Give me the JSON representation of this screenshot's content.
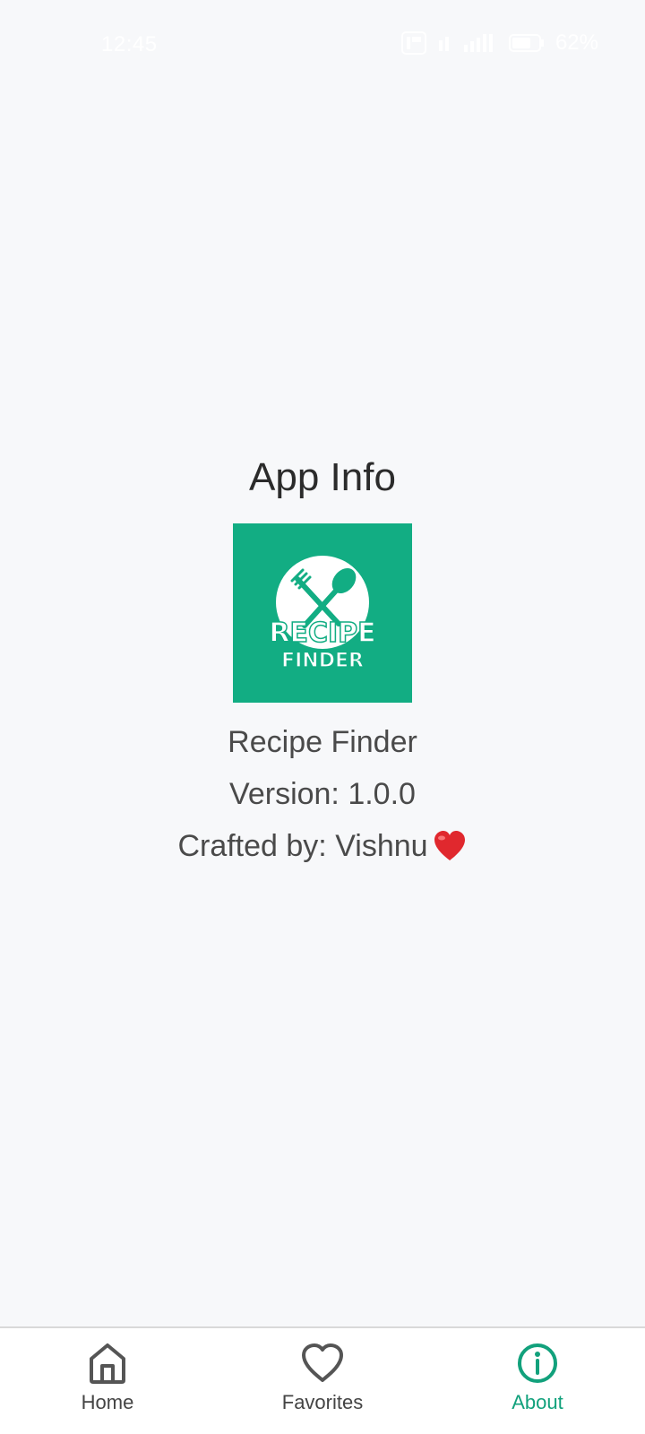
{
  "status_bar": {
    "time": "12:45",
    "battery": "62%"
  },
  "about": {
    "title": "App Info",
    "app_name": "Recipe Finder",
    "version": "Version: 1.0.0",
    "credit": "Crafted by: Vishnu",
    "logo": {
      "line1": "RECIPE",
      "line2": "FINDER"
    }
  },
  "bottom_nav": {
    "items": [
      {
        "label": "Home",
        "icon": "home-icon",
        "active": false
      },
      {
        "label": "Favorites",
        "icon": "heart-icon",
        "active": false
      },
      {
        "label": "About",
        "icon": "info-icon",
        "active": true
      }
    ]
  },
  "colors": {
    "accent": "#12ad83",
    "background": "#f7f8fa",
    "nav_active": "#12a17c"
  }
}
